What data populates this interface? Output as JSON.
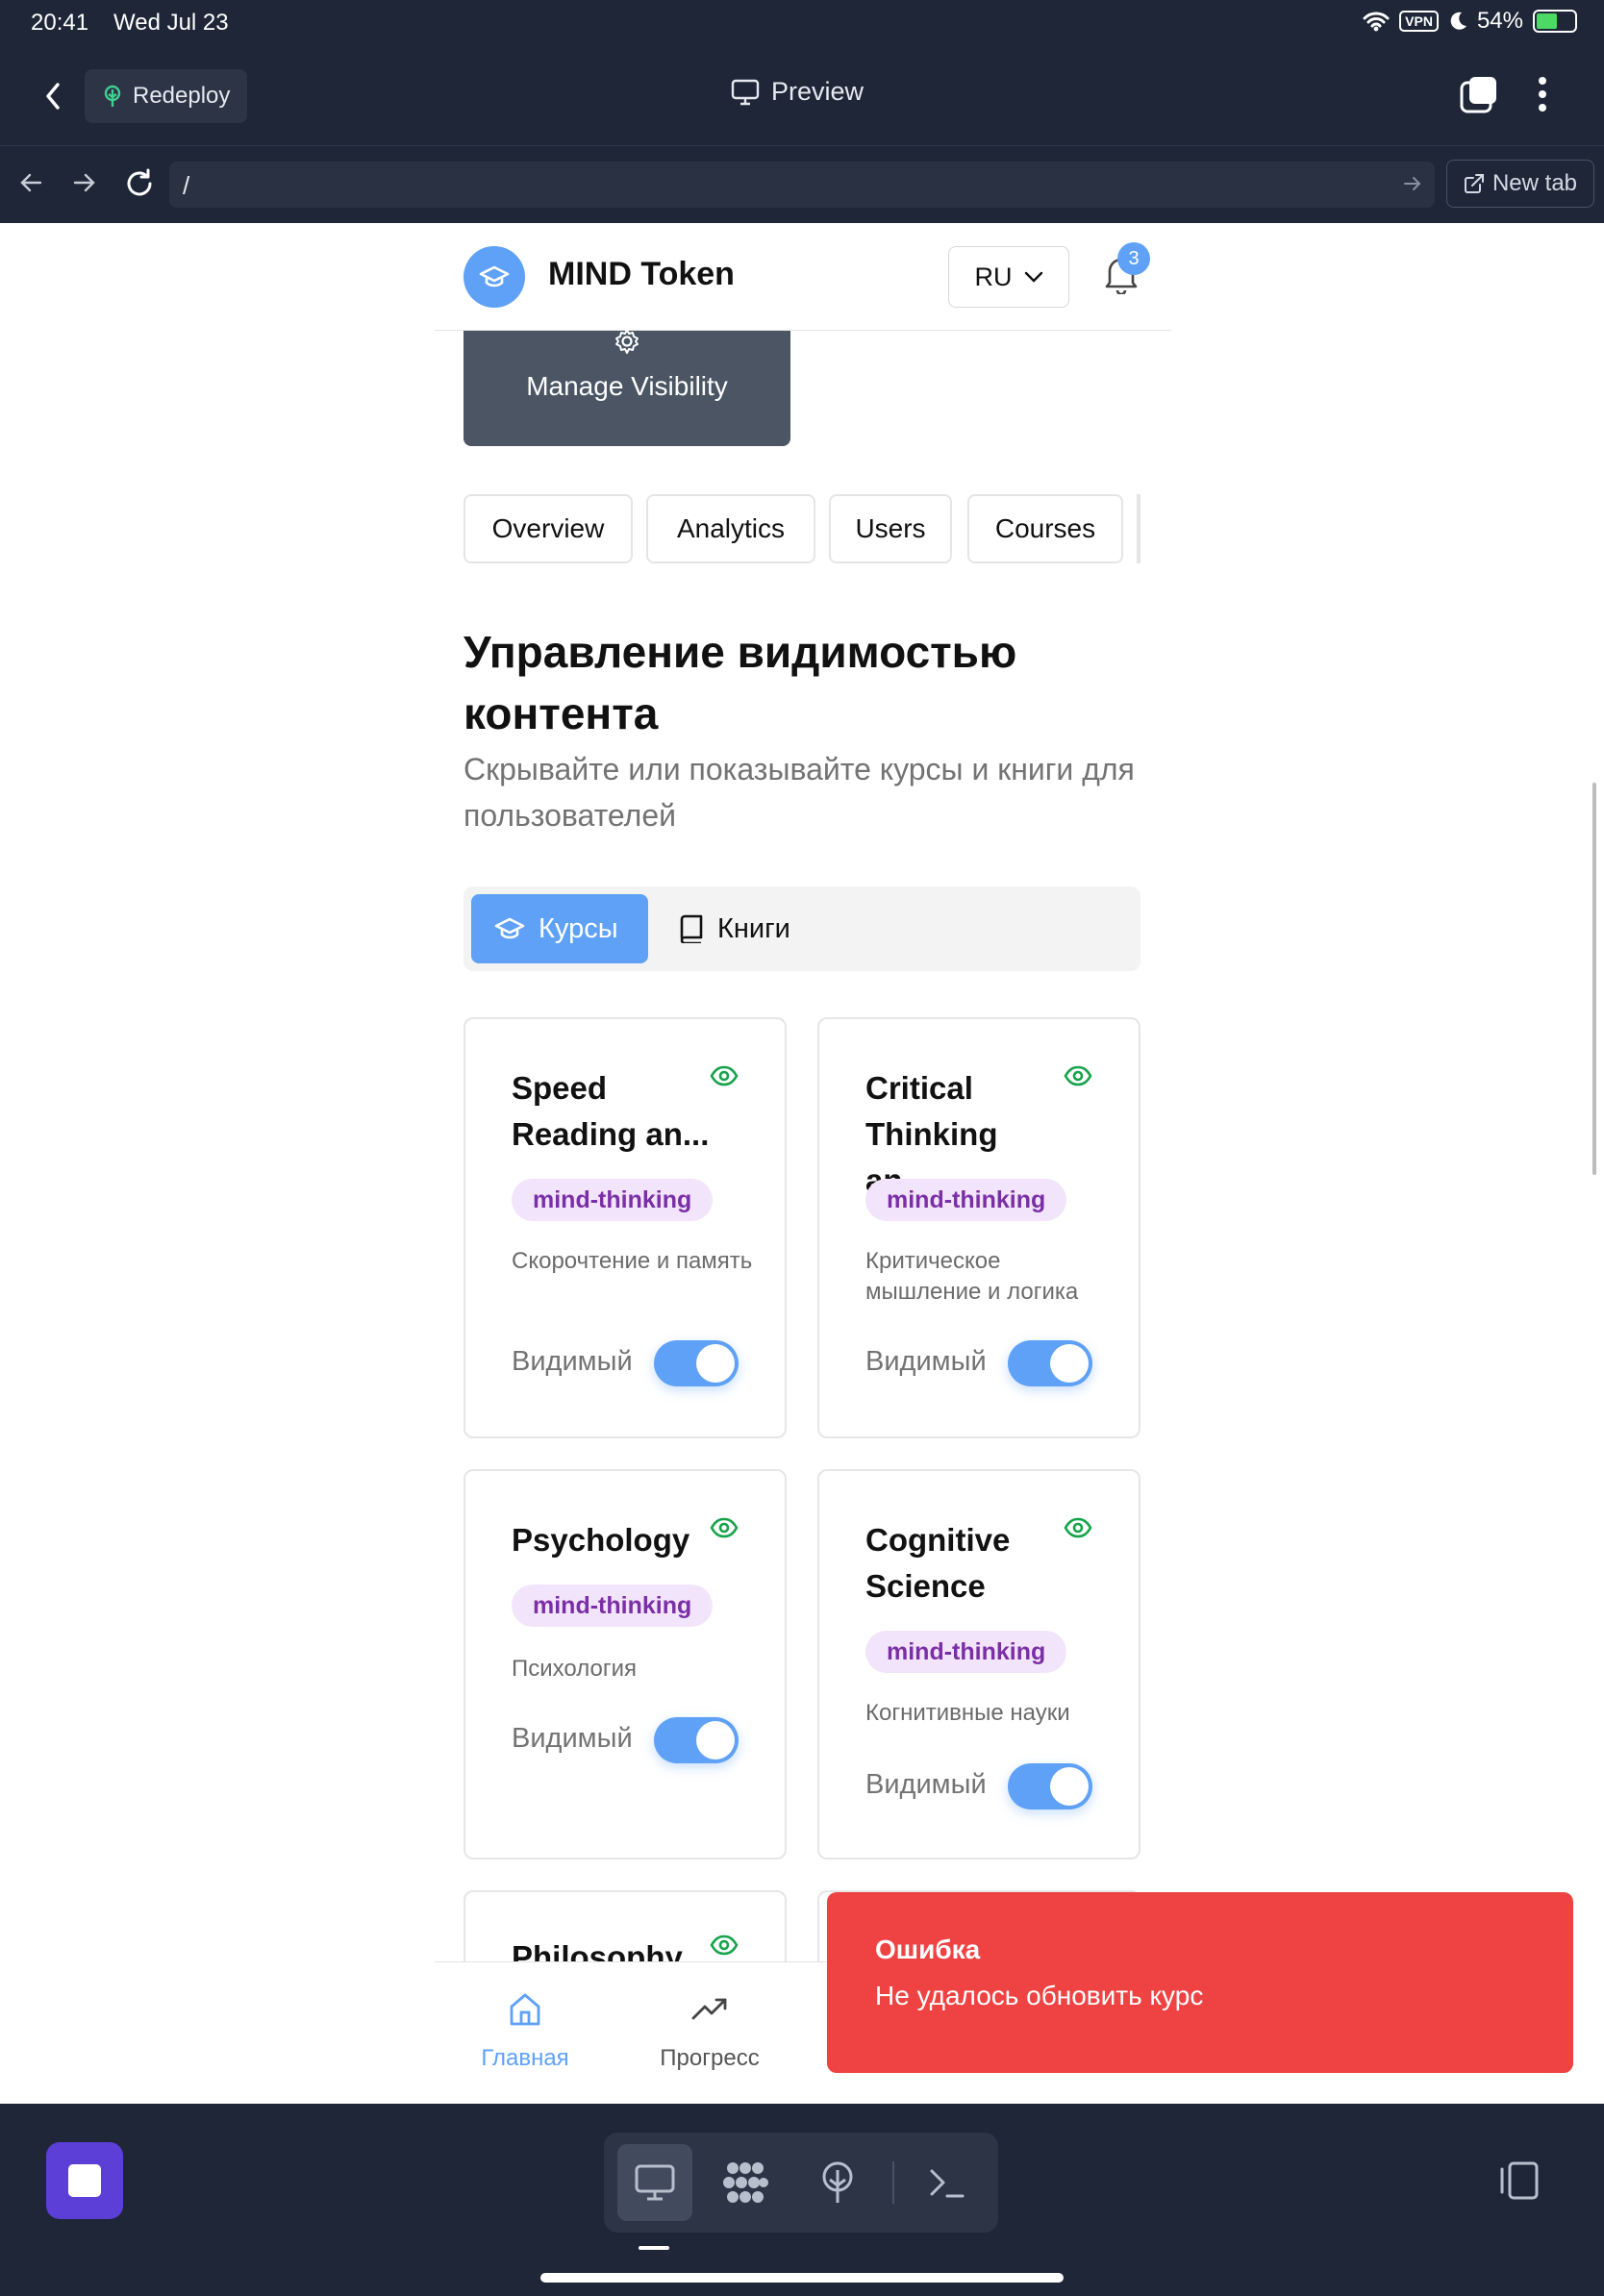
{
  "status_bar": {
    "time": "20:41",
    "date": "Wed Jul 23",
    "vpn": "VPN",
    "battery": "54%"
  },
  "app_header": {
    "redeploy_label": "Redeploy",
    "preview_label": "Preview"
  },
  "url_bar": {
    "url": "/",
    "new_tab_label": "New tab"
  },
  "site": {
    "brand": "MIND Token",
    "language": "RU",
    "notification_count": "3",
    "manage_visibility_label": "Manage Visibility",
    "admin_tabs": [
      "Overview",
      "Analytics",
      "Users",
      "Courses"
    ],
    "heading": "Управление видимостью контента",
    "subheading": "Скрывайте или показывайте курсы и книги для пользователей",
    "segments": {
      "courses": "Курсы",
      "books": "Книги",
      "active": "courses"
    },
    "cards": [
      {
        "title": "Speed Reading an...",
        "category": "mind-thinking",
        "description": "Скорочтение и память",
        "status": "Видимый",
        "visible": true
      },
      {
        "title": "Critical Thinking an...",
        "category": "mind-thinking",
        "description": "Критическое мышление и логика",
        "status": "Видимый",
        "visible": true
      },
      {
        "title": "Psychology",
        "category": "mind-thinking",
        "description": "Психология",
        "status": "Видимый",
        "visible": true
      },
      {
        "title": "Cognitive Science",
        "category": "mind-thinking",
        "description": "Когнитивные науки",
        "status": "Видимый",
        "visible": true
      },
      {
        "title": "Philosophy",
        "visible": true
      }
    ],
    "bottom_nav": [
      {
        "label": "Главная",
        "icon": "home-icon",
        "active": true
      },
      {
        "label": "Прогресс",
        "icon": "trending-up-icon",
        "active": false
      }
    ],
    "toast": {
      "title": "Ошибка",
      "message": "Не удалось обновить курс"
    }
  },
  "colors": {
    "accent": "#5ea1f6",
    "toast": "#ef4343",
    "chip_bg": "#f2e5fb",
    "chip_text": "#7b2fa6",
    "eye": "#16a34a",
    "chrome": "#1e2638",
    "manage_button": "#4b5563",
    "app_icon": "#5b3fd6"
  }
}
